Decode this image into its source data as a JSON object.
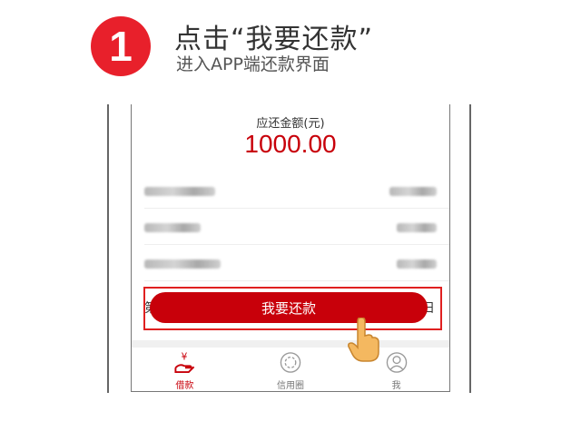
{
  "step": {
    "number": "1",
    "title": "点击“我要还款”",
    "subtitle": "进入APP端还款界面"
  },
  "repayment": {
    "amount_label": "应还金额(元)",
    "amount_value": "1000.00",
    "row_left_char": "第",
    "row_right_char": "日"
  },
  "repay_button": {
    "label": "我要还款"
  },
  "tabbar": {
    "items": [
      {
        "label": "借款",
        "icon": "hand-yen-icon",
        "active": true
      },
      {
        "label": "信用圈",
        "icon": "circle-icon",
        "active": false
      },
      {
        "label": "我",
        "icon": "user-icon",
        "active": false
      }
    ]
  },
  "colors": {
    "accent": "#c8000a",
    "badge": "#e8202b",
    "highlight": "#e02020",
    "pointer": "#f4b860"
  }
}
